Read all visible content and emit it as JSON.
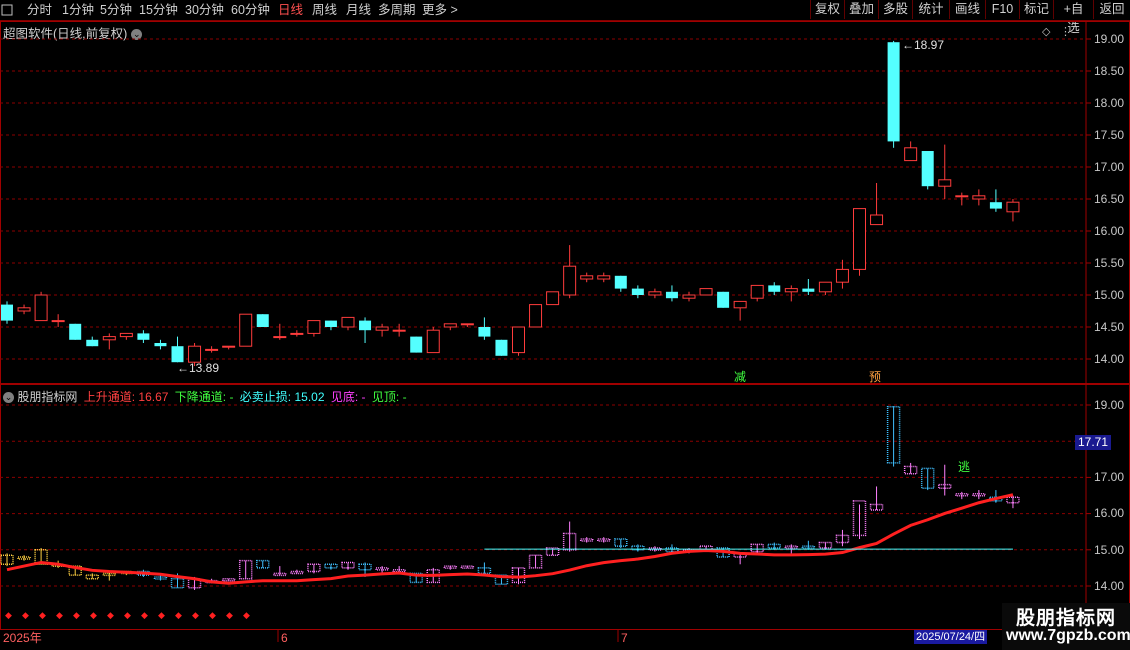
{
  "toolbar": {
    "left_items": [
      {
        "label": "分时",
        "active": false
      },
      {
        "label": "1分钟",
        "active": false
      },
      {
        "label": "5分钟",
        "active": false
      },
      {
        "label": "15分钟",
        "active": false
      },
      {
        "label": "30分钟",
        "active": false
      },
      {
        "label": "60分钟",
        "active": false
      },
      {
        "label": "日线",
        "active": true
      },
      {
        "label": "周线",
        "active": false
      },
      {
        "label": "月线",
        "active": false
      },
      {
        "label": "多周期",
        "active": false
      },
      {
        "label": "更多",
        "active": false
      }
    ],
    "right_items": [
      "复权",
      "叠加",
      "多股",
      "统计",
      "画线",
      "F10",
      "标记",
      "+自选",
      "返回"
    ],
    "first_label": "分时",
    "more_label": "更多",
    "more_glyph": ">"
  },
  "main_panel": {
    "title": "超图软件(日线,前复权)",
    "max_label": "18.97",
    "min_label": "13.89",
    "marker_jian": "减",
    "marker_yu": "预"
  },
  "indicator_panel": {
    "name": "股朋指标网",
    "fields": [
      {
        "label": "上升通道:",
        "value": "16.67",
        "color": "#ff4040"
      },
      {
        "label": "下降通道:",
        "value": "-",
        "color": "#40ff40"
      },
      {
        "label": "必卖止损:",
        "value": "15.02",
        "color": "#40ffff"
      },
      {
        "label": "见底:",
        "value": "-",
        "color": "#ff40ff"
      },
      {
        "label": "见顶:",
        "value": "-",
        "color": "#40ff40"
      }
    ],
    "current_value": "17.71",
    "escape_label": "逃"
  },
  "axis": {
    "main_ticks": [
      "19.00",
      "18.50",
      "18.00",
      "17.50",
      "17.00",
      "16.50",
      "16.00",
      "15.50",
      "15.00",
      "14.50",
      "14.00"
    ],
    "ind_ticks": [
      "19.00",
      "18.00",
      "17.00",
      "16.00",
      "15.00",
      "14.00"
    ],
    "x_labels": [
      "2025年",
      "6",
      "7"
    ],
    "date_badge": "2025/07/24/四"
  },
  "watermark": {
    "line1": "股朋指标网",
    "line2": "www.7gpzb.com"
  },
  "colors": {
    "up": "#ff3c3c",
    "down": "#54ffff",
    "grid": "#8b0000",
    "background": "#000000"
  },
  "chart_data": {
    "type": "candlestick",
    "ylim": [
      13.7,
      19.2
    ],
    "columns": [
      "open",
      "high",
      "low",
      "close"
    ],
    "candles": [
      [
        14.85,
        14.9,
        14.55,
        14.6
      ],
      [
        14.75,
        14.85,
        14.7,
        14.8
      ],
      [
        14.6,
        15.05,
        14.6,
        15.0
      ],
      [
        14.6,
        14.7,
        14.5,
        14.6
      ],
      [
        14.55,
        14.55,
        14.3,
        14.3
      ],
      [
        14.3,
        14.35,
        14.2,
        14.2
      ],
      [
        14.3,
        14.4,
        14.15,
        14.35
      ],
      [
        14.35,
        14.4,
        14.3,
        14.4
      ],
      [
        14.4,
        14.45,
        14.25,
        14.3
      ],
      [
        14.25,
        14.3,
        14.15,
        14.2
      ],
      [
        14.2,
        14.35,
        13.95,
        13.95
      ],
      [
        13.95,
        14.25,
        13.89,
        14.2
      ],
      [
        14.15,
        14.2,
        14.1,
        14.15
      ],
      [
        14.2,
        14.2,
        14.15,
        14.2
      ],
      [
        14.2,
        14.7,
        14.2,
        14.7
      ],
      [
        14.7,
        14.7,
        14.5,
        14.5
      ],
      [
        14.35,
        14.55,
        14.3,
        14.35
      ],
      [
        14.4,
        14.45,
        14.35,
        14.4
      ],
      [
        14.4,
        14.6,
        14.35,
        14.6
      ],
      [
        14.6,
        14.6,
        14.45,
        14.5
      ],
      [
        14.5,
        14.65,
        14.45,
        14.65
      ],
      [
        14.6,
        14.65,
        14.25,
        14.45
      ],
      [
        14.45,
        14.55,
        14.35,
        14.5
      ],
      [
        14.45,
        14.55,
        14.35,
        14.45
      ],
      [
        14.35,
        14.35,
        14.1,
        14.1
      ],
      [
        14.1,
        14.5,
        14.1,
        14.45
      ],
      [
        14.5,
        14.55,
        14.45,
        14.55
      ],
      [
        14.55,
        14.55,
        14.5,
        14.55
      ],
      [
        14.5,
        14.65,
        14.3,
        14.35
      ],
      [
        14.3,
        14.3,
        14.05,
        14.05
      ],
      [
        14.1,
        14.5,
        14.05,
        14.5
      ],
      [
        14.5,
        14.85,
        14.5,
        14.85
      ],
      [
        14.85,
        15.05,
        14.85,
        15.05
      ],
      [
        15.0,
        15.78,
        14.95,
        15.45
      ],
      [
        15.25,
        15.35,
        15.2,
        15.3
      ],
      [
        15.25,
        15.35,
        15.2,
        15.3
      ],
      [
        15.3,
        15.3,
        15.05,
        15.1
      ],
      [
        15.1,
        15.15,
        14.95,
        15.0
      ],
      [
        15.0,
        15.1,
        14.95,
        15.05
      ],
      [
        15.05,
        15.15,
        14.9,
        14.95
      ],
      [
        14.95,
        15.05,
        14.9,
        15.0
      ],
      [
        15.0,
        15.1,
        15.0,
        15.1
      ],
      [
        15.05,
        15.05,
        14.8,
        14.8
      ],
      [
        14.8,
        14.9,
        14.6,
        14.9
      ],
      [
        14.95,
        15.15,
        14.9,
        15.15
      ],
      [
        15.15,
        15.2,
        15.0,
        15.05
      ],
      [
        15.05,
        15.15,
        14.9,
        15.1
      ],
      [
        15.1,
        15.25,
        15.0,
        15.05
      ],
      [
        15.05,
        15.2,
        15.0,
        15.2
      ],
      [
        15.2,
        15.55,
        15.1,
        15.4
      ],
      [
        15.4,
        16.25,
        15.3,
        16.35
      ],
      [
        16.1,
        16.75,
        16.1,
        16.25
      ],
      [
        18.95,
        18.97,
        17.3,
        17.4
      ],
      [
        17.1,
        17.4,
        17.1,
        17.3
      ],
      [
        17.25,
        17.25,
        16.65,
        16.7
      ],
      [
        16.7,
        17.35,
        16.5,
        16.8
      ],
      [
        16.55,
        16.6,
        16.4,
        16.55
      ],
      [
        16.5,
        16.65,
        16.4,
        16.55
      ],
      [
        16.45,
        16.65,
        16.3,
        16.35
      ],
      [
        16.3,
        16.5,
        16.15,
        16.45
      ]
    ]
  }
}
